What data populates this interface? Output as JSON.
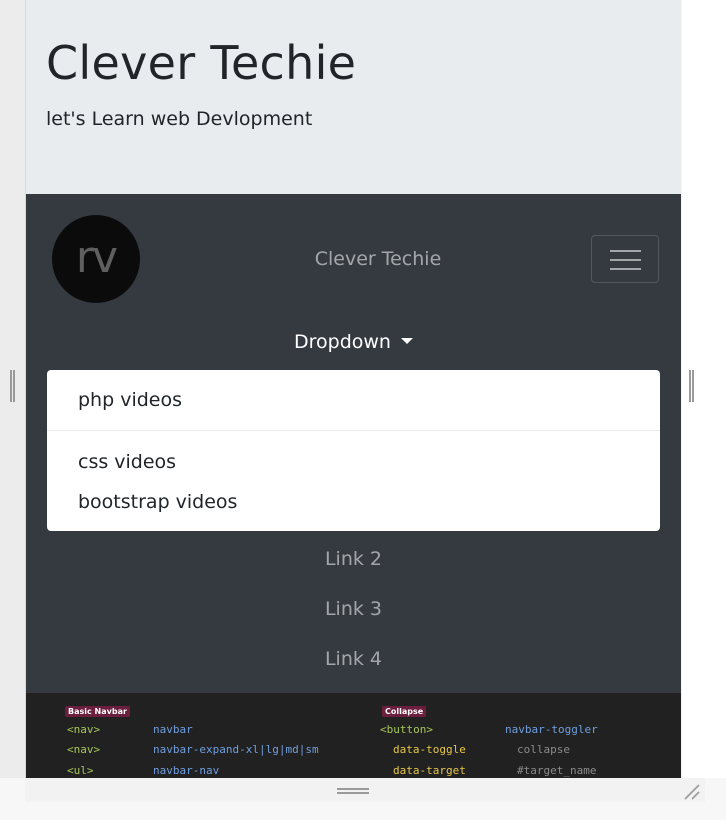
{
  "jumbotron": {
    "title": "Clever Techie",
    "lead": "let's Learn web Devlopment"
  },
  "navbar": {
    "logo_text": "rv",
    "brand": "Clever Techie",
    "toggler_icon": "hamburger-icon",
    "dropdown": {
      "label": "Dropdown",
      "items": [
        "php videos",
        "css videos",
        "bootstrap videos"
      ]
    },
    "links": [
      "Link 2",
      "Link 3",
      "Link 4"
    ]
  },
  "cheatsheet": {
    "left": {
      "badge": "Basic Navbar",
      "rows": [
        {
          "tag": "<nav>",
          "cls": "navbar"
        },
        {
          "tag": "<nav>",
          "cls": "navbar-expand-xl|lg|md|sm"
        },
        {
          "tag": "<ul>",
          "cls": "navbar-nav"
        }
      ]
    },
    "right": {
      "badge": "Collapse",
      "rows": [
        {
          "tag": "<button>",
          "cls": "navbar-toggler",
          "value": ""
        },
        {
          "tag": "data-toggle",
          "cls": "",
          "value": "collapse"
        },
        {
          "tag": "data-target",
          "cls": "",
          "value": "#target_name"
        }
      ]
    }
  },
  "colors": {
    "jumbotron_bg": "#e9ecef",
    "navbar_bg": "#343a40",
    "code_bg": "#212121"
  }
}
